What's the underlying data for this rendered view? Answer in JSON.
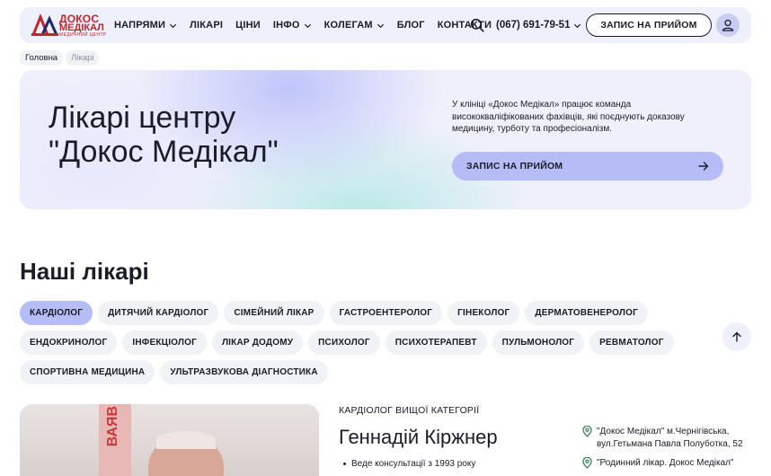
{
  "header": {
    "logo": {
      "line1": "ДОКОС",
      "line2": "МЕДІКАЛ",
      "line3": "МЕДИЧНИЙ ЦЕНТР"
    },
    "nav": [
      {
        "label": "НАПРЯМИ",
        "dropdown": true
      },
      {
        "label": "ЛІКАРІ",
        "dropdown": false
      },
      {
        "label": "ЦІНИ",
        "dropdown": false
      },
      {
        "label": "ІНФО",
        "dropdown": true
      },
      {
        "label": "КОЛЕГАМ",
        "dropdown": true
      },
      {
        "label": "БЛОГ",
        "dropdown": false
      },
      {
        "label": "КОНТАКТИ",
        "dropdown": false
      }
    ],
    "phone": "(067) 691-79-51",
    "cta_label": "ЗАПИС НА ПРИЙОМ"
  },
  "breadcrumb": {
    "home": "Головна",
    "current": "Лікарі"
  },
  "hero": {
    "title": "Лікарі центру \"Докос Медікал\"",
    "text": "У клініці «Докос Медікал» працює команда висококваліфікованих фахівців, які поєднують доказову медицину, турботу та професіоналізм.",
    "cta_label": "ЗАПИС НА ПРИЙОМ"
  },
  "doctors_section": {
    "title": "Наші лікарі",
    "filters": [
      {
        "label": "КАРДІОЛОГ",
        "active": true
      },
      {
        "label": "ДИТЯЧИЙ КАРДІОЛОГ",
        "active": false
      },
      {
        "label": "СІМЕЙНИЙ ЛІКАР",
        "active": false
      },
      {
        "label": "ГАСТРОЕНТЕРОЛОГ",
        "active": false
      },
      {
        "label": "ГІНЕКОЛОГ",
        "active": false
      },
      {
        "label": "ДЕРМАТОВЕНЕРОЛОГ",
        "active": false
      },
      {
        "label": "ЕНДОКРИНОЛОГ",
        "active": false
      },
      {
        "label": "ІНФЕКЦІОЛОГ",
        "active": false
      },
      {
        "label": "ЛІКАР ДОДОМУ",
        "active": false
      },
      {
        "label": "ПСИХОЛОГ",
        "active": false
      },
      {
        "label": "ПСИХОТЕРАПЕВТ",
        "active": false
      },
      {
        "label": "ПУЛЬМОНОЛОГ",
        "active": false
      },
      {
        "label": "РЕВМАТОЛОГ",
        "active": false
      },
      {
        "label": "СПОРТИВНА МЕДИЦИНА",
        "active": false
      },
      {
        "label": "УЛЬТРАЗВУКОВА ДІАГНОСТИКА",
        "active": false
      }
    ]
  },
  "doctor": {
    "category": "КАРДІОЛОГ ВИЩОЇ КАТЕГОРІЇ",
    "name": "Геннадій Кіржнер",
    "facts": [
      "Веде консультації з 1993 року"
    ],
    "locations": [
      "\"Докос Медікал\" м.Чернігівська, вул.Гетьмана Павла Полуботка, 52",
      "\"Родинний лікар. Докос Медікал\""
    ],
    "photo_sign": "ВАЯВ"
  },
  "colors": {
    "accent": "#b6bcf6",
    "brand_red": "#c8222b",
    "header_bg": "#eef0fb",
    "chip_bg": "#f1f2f6"
  },
  "icons": {
    "search": "search-icon",
    "user": "user-icon",
    "arrow_right": "arrow-right-icon",
    "arrow_up": "arrow-up-icon",
    "pin": "location-pin-icon"
  }
}
